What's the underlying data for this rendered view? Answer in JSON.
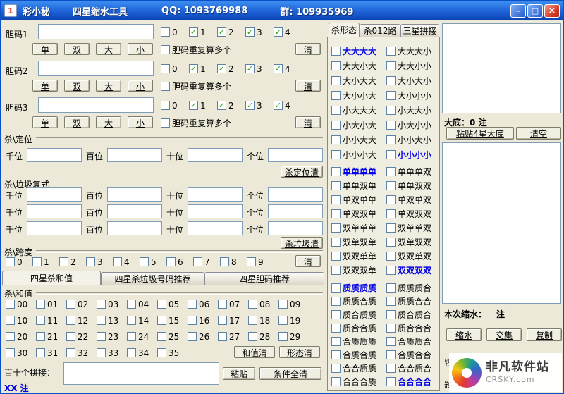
{
  "window": {
    "icon_text": "1",
    "title_app": "彩小秘",
    "title_tool": "四星缩水工具",
    "title_qq": "QQ: 1093769988",
    "title_group": "群: 109935969",
    "minimize_glyph": "–",
    "maximize_glyph": "□",
    "close_glyph": "×"
  },
  "dan_blocks": [
    {
      "label": "胆码1",
      "value": "",
      "digits": [
        {
          "t": "0",
          "c": false
        },
        {
          "t": "1",
          "c": true
        },
        {
          "t": "2",
          "c": true
        },
        {
          "t": "3",
          "c": true
        },
        {
          "t": "4",
          "c": true
        }
      ],
      "buttons": [
        "单",
        "双",
        "大",
        "小"
      ],
      "repeat_label": "胆码重复算多个",
      "repeat_checked": false,
      "clear_label": "清"
    },
    {
      "label": "胆码2",
      "value": "",
      "digits": [
        {
          "t": "0",
          "c": false
        },
        {
          "t": "1",
          "c": true
        },
        {
          "t": "2",
          "c": true
        },
        {
          "t": "3",
          "c": true
        },
        {
          "t": "4",
          "c": true
        }
      ],
      "buttons": [
        "单",
        "双",
        "大",
        "小"
      ],
      "repeat_label": "胆码重复算多个",
      "repeat_checked": false,
      "clear_label": "清"
    },
    {
      "label": "胆码3",
      "value": "",
      "digits": [
        {
          "t": "0",
          "c": false
        },
        {
          "t": "1",
          "c": true
        },
        {
          "t": "2",
          "c": true
        },
        {
          "t": "3",
          "c": true
        },
        {
          "t": "4",
          "c": true
        }
      ],
      "buttons": [
        "单",
        "双",
        "大",
        "小"
      ],
      "repeat_label": "胆码重复算多个",
      "repeat_checked": false,
      "clear_label": "清"
    }
  ],
  "kill_position": {
    "section_label": "杀\\定位",
    "fields": [
      {
        "label": "千位",
        "value": ""
      },
      {
        "label": "百位",
        "value": ""
      },
      {
        "label": "十位",
        "value": ""
      },
      {
        "label": "个位",
        "value": ""
      }
    ],
    "clear_button": "杀定位清"
  },
  "kill_garbage": {
    "section_label": "杀\\垃圾复式",
    "rows": [
      {
        "fields": [
          {
            "label": "千位",
            "value": ""
          },
          {
            "label": "百位",
            "value": ""
          },
          {
            "label": "十位",
            "value": ""
          },
          {
            "label": "个位",
            "value": ""
          }
        ]
      },
      {
        "fields": [
          {
            "label": "千位",
            "value": ""
          },
          {
            "label": "百位",
            "value": ""
          },
          {
            "label": "十位",
            "value": ""
          },
          {
            "label": "个位",
            "value": ""
          }
        ]
      },
      {
        "fields": [
          {
            "label": "千位",
            "value": ""
          },
          {
            "label": "百位",
            "value": ""
          },
          {
            "label": "十位",
            "value": ""
          },
          {
            "label": "个位",
            "value": ""
          }
        ]
      }
    ],
    "clear_button": "杀垃圾清"
  },
  "kill_span": {
    "section_label": "杀\\跨度",
    "digits": [
      "0",
      "1",
      "2",
      "3",
      "4",
      "5",
      "6",
      "7",
      "8",
      "9"
    ],
    "clear_button": "清"
  },
  "left_tabs": [
    {
      "label": "四星杀和值",
      "active": true
    },
    {
      "label": "四星杀垃圾号码推荐",
      "active": false
    },
    {
      "label": "四星胆码推荐",
      "active": false
    }
  ],
  "kill_sum": {
    "section_label": "杀\\和值",
    "values": [
      "00",
      "01",
      "02",
      "03",
      "04",
      "05",
      "06",
      "07",
      "08",
      "09",
      "10",
      "11",
      "12",
      "13",
      "14",
      "15",
      "16",
      "17",
      "18",
      "19",
      "20",
      "21",
      "22",
      "23",
      "24",
      "25",
      "26",
      "27",
      "28",
      "29",
      "30",
      "31",
      "32",
      "33",
      "34",
      "35"
    ],
    "buttons": [
      "和值清",
      "形态清"
    ]
  },
  "splice": {
    "label": "百十个拼接：",
    "value": "",
    "paste_button": "粘贴",
    "clear_all_button": "条件全清",
    "note": "XX 注"
  },
  "right_tabs": [
    {
      "label": "杀形态",
      "active": true
    },
    {
      "label": "杀012路",
      "active": false
    },
    {
      "label": "三星拼接",
      "active": false
    }
  ],
  "pattern_groups": [
    {
      "name": "big-small",
      "items": [
        {
          "t": "大大大大",
          "hl": true
        },
        {
          "t": "大大大小",
          "hl": false
        },
        {
          "t": "大大小大",
          "hl": false
        },
        {
          "t": "大大小小",
          "hl": false
        },
        {
          "t": "大小大大",
          "hl": false
        },
        {
          "t": "大小大小",
          "hl": false
        },
        {
          "t": "大小小大",
          "hl": false
        },
        {
          "t": "大小小小",
          "hl": false
        },
        {
          "t": "小大大大",
          "hl": false
        },
        {
          "t": "小大大小",
          "hl": false
        },
        {
          "t": "小大小大",
          "hl": false
        },
        {
          "t": "小大小小",
          "hl": false
        },
        {
          "t": "小小大大",
          "hl": false
        },
        {
          "t": "小小大小",
          "hl": false
        },
        {
          "t": "小小小大",
          "hl": false
        },
        {
          "t": "小小小小",
          "hl": true
        }
      ]
    },
    {
      "name": "odd-even",
      "items": [
        {
          "t": "单单单单",
          "hl": true
        },
        {
          "t": "单单单双",
          "hl": false
        },
        {
          "t": "单单双单",
          "hl": false
        },
        {
          "t": "单单双双",
          "hl": false
        },
        {
          "t": "单双单单",
          "hl": false
        },
        {
          "t": "单双单双",
          "hl": false
        },
        {
          "t": "单双双单",
          "hl": false
        },
        {
          "t": "单双双双",
          "hl": false
        },
        {
          "t": "双单单单",
          "hl": false
        },
        {
          "t": "双单单双",
          "hl": false
        },
        {
          "t": "双单双单",
          "hl": false
        },
        {
          "t": "双单双双",
          "hl": false
        },
        {
          "t": "双双单单",
          "hl": false
        },
        {
          "t": "双双单双",
          "hl": false
        },
        {
          "t": "双双双单",
          "hl": false
        },
        {
          "t": "双双双双",
          "hl": true
        }
      ]
    },
    {
      "name": "prime-composite",
      "items": [
        {
          "t": "质质质质",
          "hl": true
        },
        {
          "t": "质质质合",
          "hl": false
        },
        {
          "t": "质质合质",
          "hl": false
        },
        {
          "t": "质质合合",
          "hl": false
        },
        {
          "t": "质合质质",
          "hl": false
        },
        {
          "t": "质合质合",
          "hl": false
        },
        {
          "t": "质合合质",
          "hl": false
        },
        {
          "t": "质合合合",
          "hl": false
        },
        {
          "t": "合质质质",
          "hl": false
        },
        {
          "t": "合质质合",
          "hl": false
        },
        {
          "t": "合质合质",
          "hl": false
        },
        {
          "t": "合质合合",
          "hl": false
        },
        {
          "t": "合合质质",
          "hl": false
        },
        {
          "t": "合合质合",
          "hl": false
        },
        {
          "t": "合合合质",
          "hl": false
        },
        {
          "t": "合合合合",
          "hl": true
        }
      ]
    }
  ],
  "right_panel": {
    "dadi_label": "大底：",
    "dadi_count": "0",
    "dadi_unit": "注",
    "paste_button": "粘贴4星大底",
    "clear_button": "清空",
    "result_label": "本次缩水：",
    "result_unit": "注",
    "buttons": [
      "缩水",
      "交集",
      "复制"
    ],
    "frag1": "输",
    "frag2": "题"
  },
  "watermark": {
    "site": "非凡软件站",
    "domain": "CRSKY.com"
  }
}
